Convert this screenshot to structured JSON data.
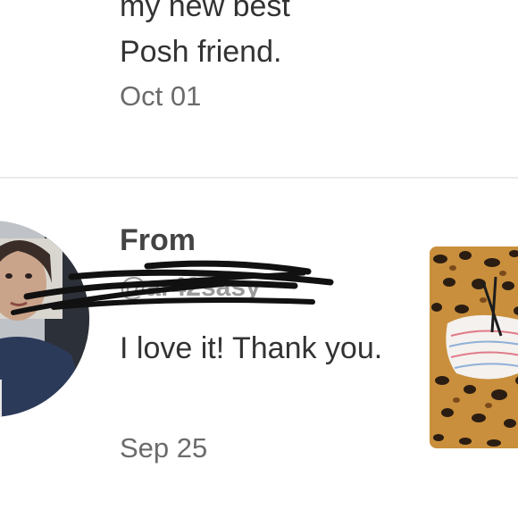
{
  "previous_message": {
    "text_line1": "my new best",
    "text_line2": "Posh friend.",
    "date": "Oct 01"
  },
  "message": {
    "from_label": "From",
    "handle": "@ar42sasy",
    "text": "I love it! Thank you.",
    "date": "Sep 25"
  },
  "colors": {
    "text": "#333333",
    "muted": "#6b6b6b",
    "divider": "#eaeaea",
    "redaction": "#111111"
  }
}
